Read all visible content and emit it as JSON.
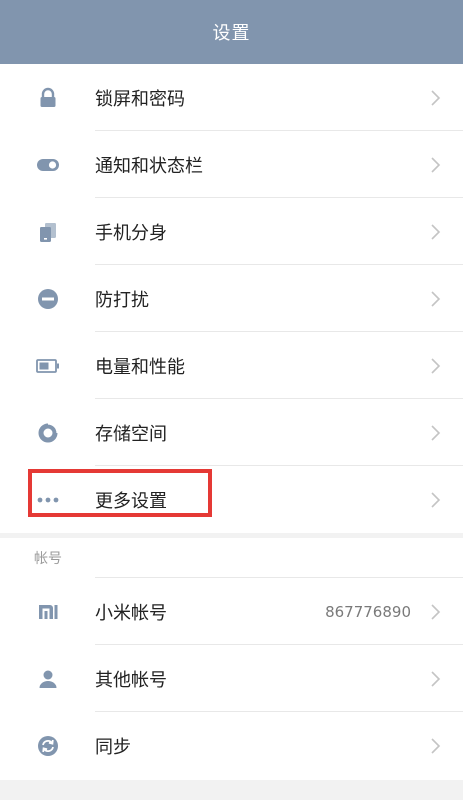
{
  "header": {
    "title": "设置"
  },
  "settings_items": [
    {
      "label": "锁屏和密码",
      "icon": "lock-icon"
    },
    {
      "label": "通知和状态栏",
      "icon": "toggle-icon"
    },
    {
      "label": "手机分身",
      "icon": "phone-clone-icon"
    },
    {
      "label": "防打扰",
      "icon": "do-not-disturb-icon"
    },
    {
      "label": "电量和性能",
      "icon": "battery-icon"
    },
    {
      "label": "存储空间",
      "icon": "storage-icon"
    },
    {
      "label": "更多设置",
      "icon": "more-icon"
    }
  ],
  "account_section": {
    "header": "帐号",
    "items": [
      {
        "label": "小米帐号",
        "value": "867776890",
        "icon": "mi-logo-icon"
      },
      {
        "label": "其他帐号",
        "icon": "person-icon"
      },
      {
        "label": "同步",
        "icon": "sync-icon"
      }
    ]
  },
  "colors": {
    "header_bg": "#8195ae",
    "icon": "#8195ae",
    "highlight": "#e53935"
  }
}
